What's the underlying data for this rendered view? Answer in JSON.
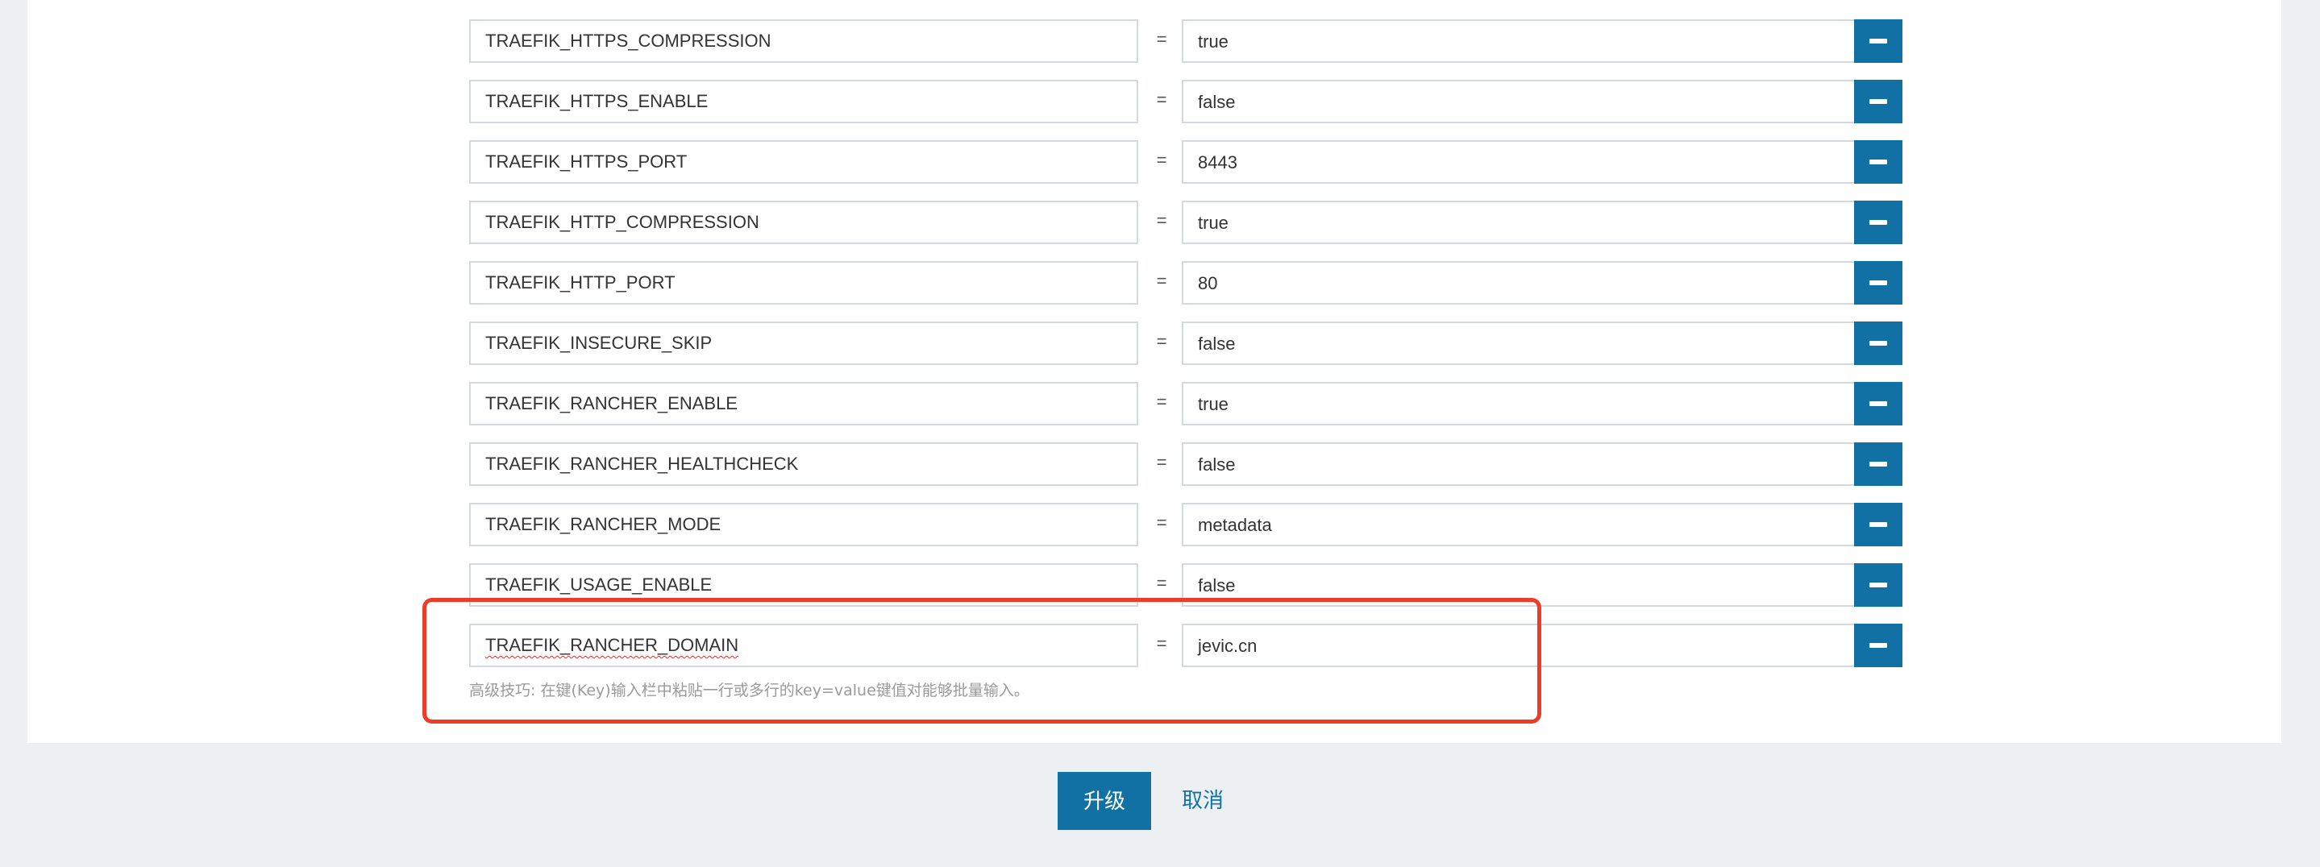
{
  "env_vars": [
    {
      "key": "TRAEFIK_HTTPS_COMPRESSION",
      "value": "true"
    },
    {
      "key": "TRAEFIK_HTTPS_ENABLE",
      "value": "false"
    },
    {
      "key": "TRAEFIK_HTTPS_PORT",
      "value": "8443"
    },
    {
      "key": "TRAEFIK_HTTP_COMPRESSION",
      "value": "true"
    },
    {
      "key": "TRAEFIK_HTTP_PORT",
      "value": "80"
    },
    {
      "key": "TRAEFIK_INSECURE_SKIP",
      "value": "false"
    },
    {
      "key": "TRAEFIK_RANCHER_ENABLE",
      "value": "true"
    },
    {
      "key": "TRAEFIK_RANCHER_HEALTHCHECK",
      "value": "false"
    },
    {
      "key": "TRAEFIK_RANCHER_MODE",
      "value": "metadata"
    },
    {
      "key": "TRAEFIK_USAGE_ENABLE",
      "value": "false"
    },
    {
      "key": "TRAEFIK_RANCHER_DOMAIN",
      "value": "jevic.cn"
    }
  ],
  "separator": "=",
  "hint": "高级技巧: 在键(Key)输入栏中粘贴一行或多行的key=value键值对能够批量输入。",
  "actions": {
    "upgrade_label": "升级",
    "cancel_label": "取消"
  },
  "colors": {
    "primary": "#1171a4",
    "highlight": "#ee3c29",
    "page_background": "#edf0f2"
  },
  "icons": {
    "remove": "minus-icon"
  }
}
